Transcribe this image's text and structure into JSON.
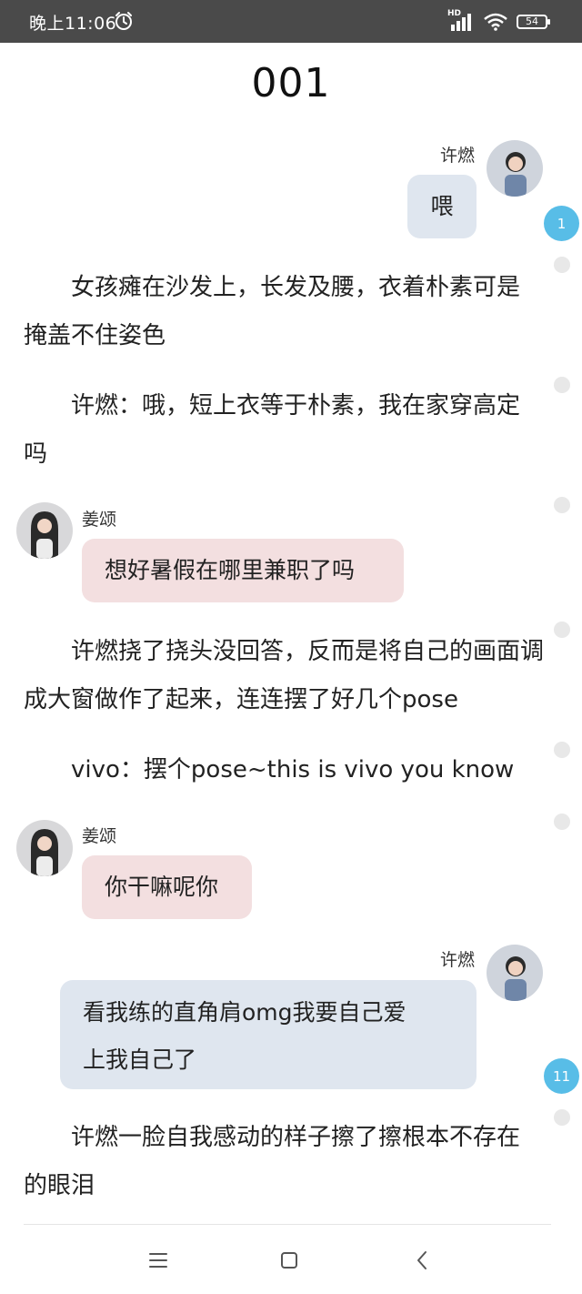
{
  "status_bar": {
    "time": "晚上11:06",
    "network": "HD",
    "battery": "54"
  },
  "title": "001",
  "messages": [
    {
      "speaker": "许燃",
      "text": "喂"
    },
    {
      "narration": "女孩瘫在沙发上，长发及腰，衣着朴素可是掩盖不住姿色"
    },
    {
      "narration": "许燃：哦，短上衣等于朴素，我在家穿高定吗"
    },
    {
      "speaker": "姜颂",
      "text": "想好暑假在哪里兼职了吗"
    },
    {
      "narration": "许燃挠了挠头没回答，反而是将自己的画面调成大窗做作了起来，连连摆了好几个pose"
    },
    {
      "narration": "vivo：摆个pose~this is vivo you know"
    },
    {
      "speaker": "姜颂",
      "text": "你干嘛呢你"
    },
    {
      "speaker": "许燃",
      "text_line1": "看我练的直角肩omg我要自己爱",
      "text_line2": "上我自己了"
    },
    {
      "narration": "许燃一脸自我感动的样子擦了擦根本不存在的眼泪"
    }
  ],
  "comment_badges": [
    "1",
    "11"
  ],
  "colors": {
    "status_bar": "#4a4a4a",
    "bubble_right": "#dfe6ef",
    "bubble_left": "#f3dfe0",
    "badge": "#58bde7"
  },
  "icons": [
    "alarm-icon",
    "signal-icon",
    "wifi-icon",
    "battery-icon",
    "menu-icon",
    "home-icon",
    "back-icon"
  ]
}
